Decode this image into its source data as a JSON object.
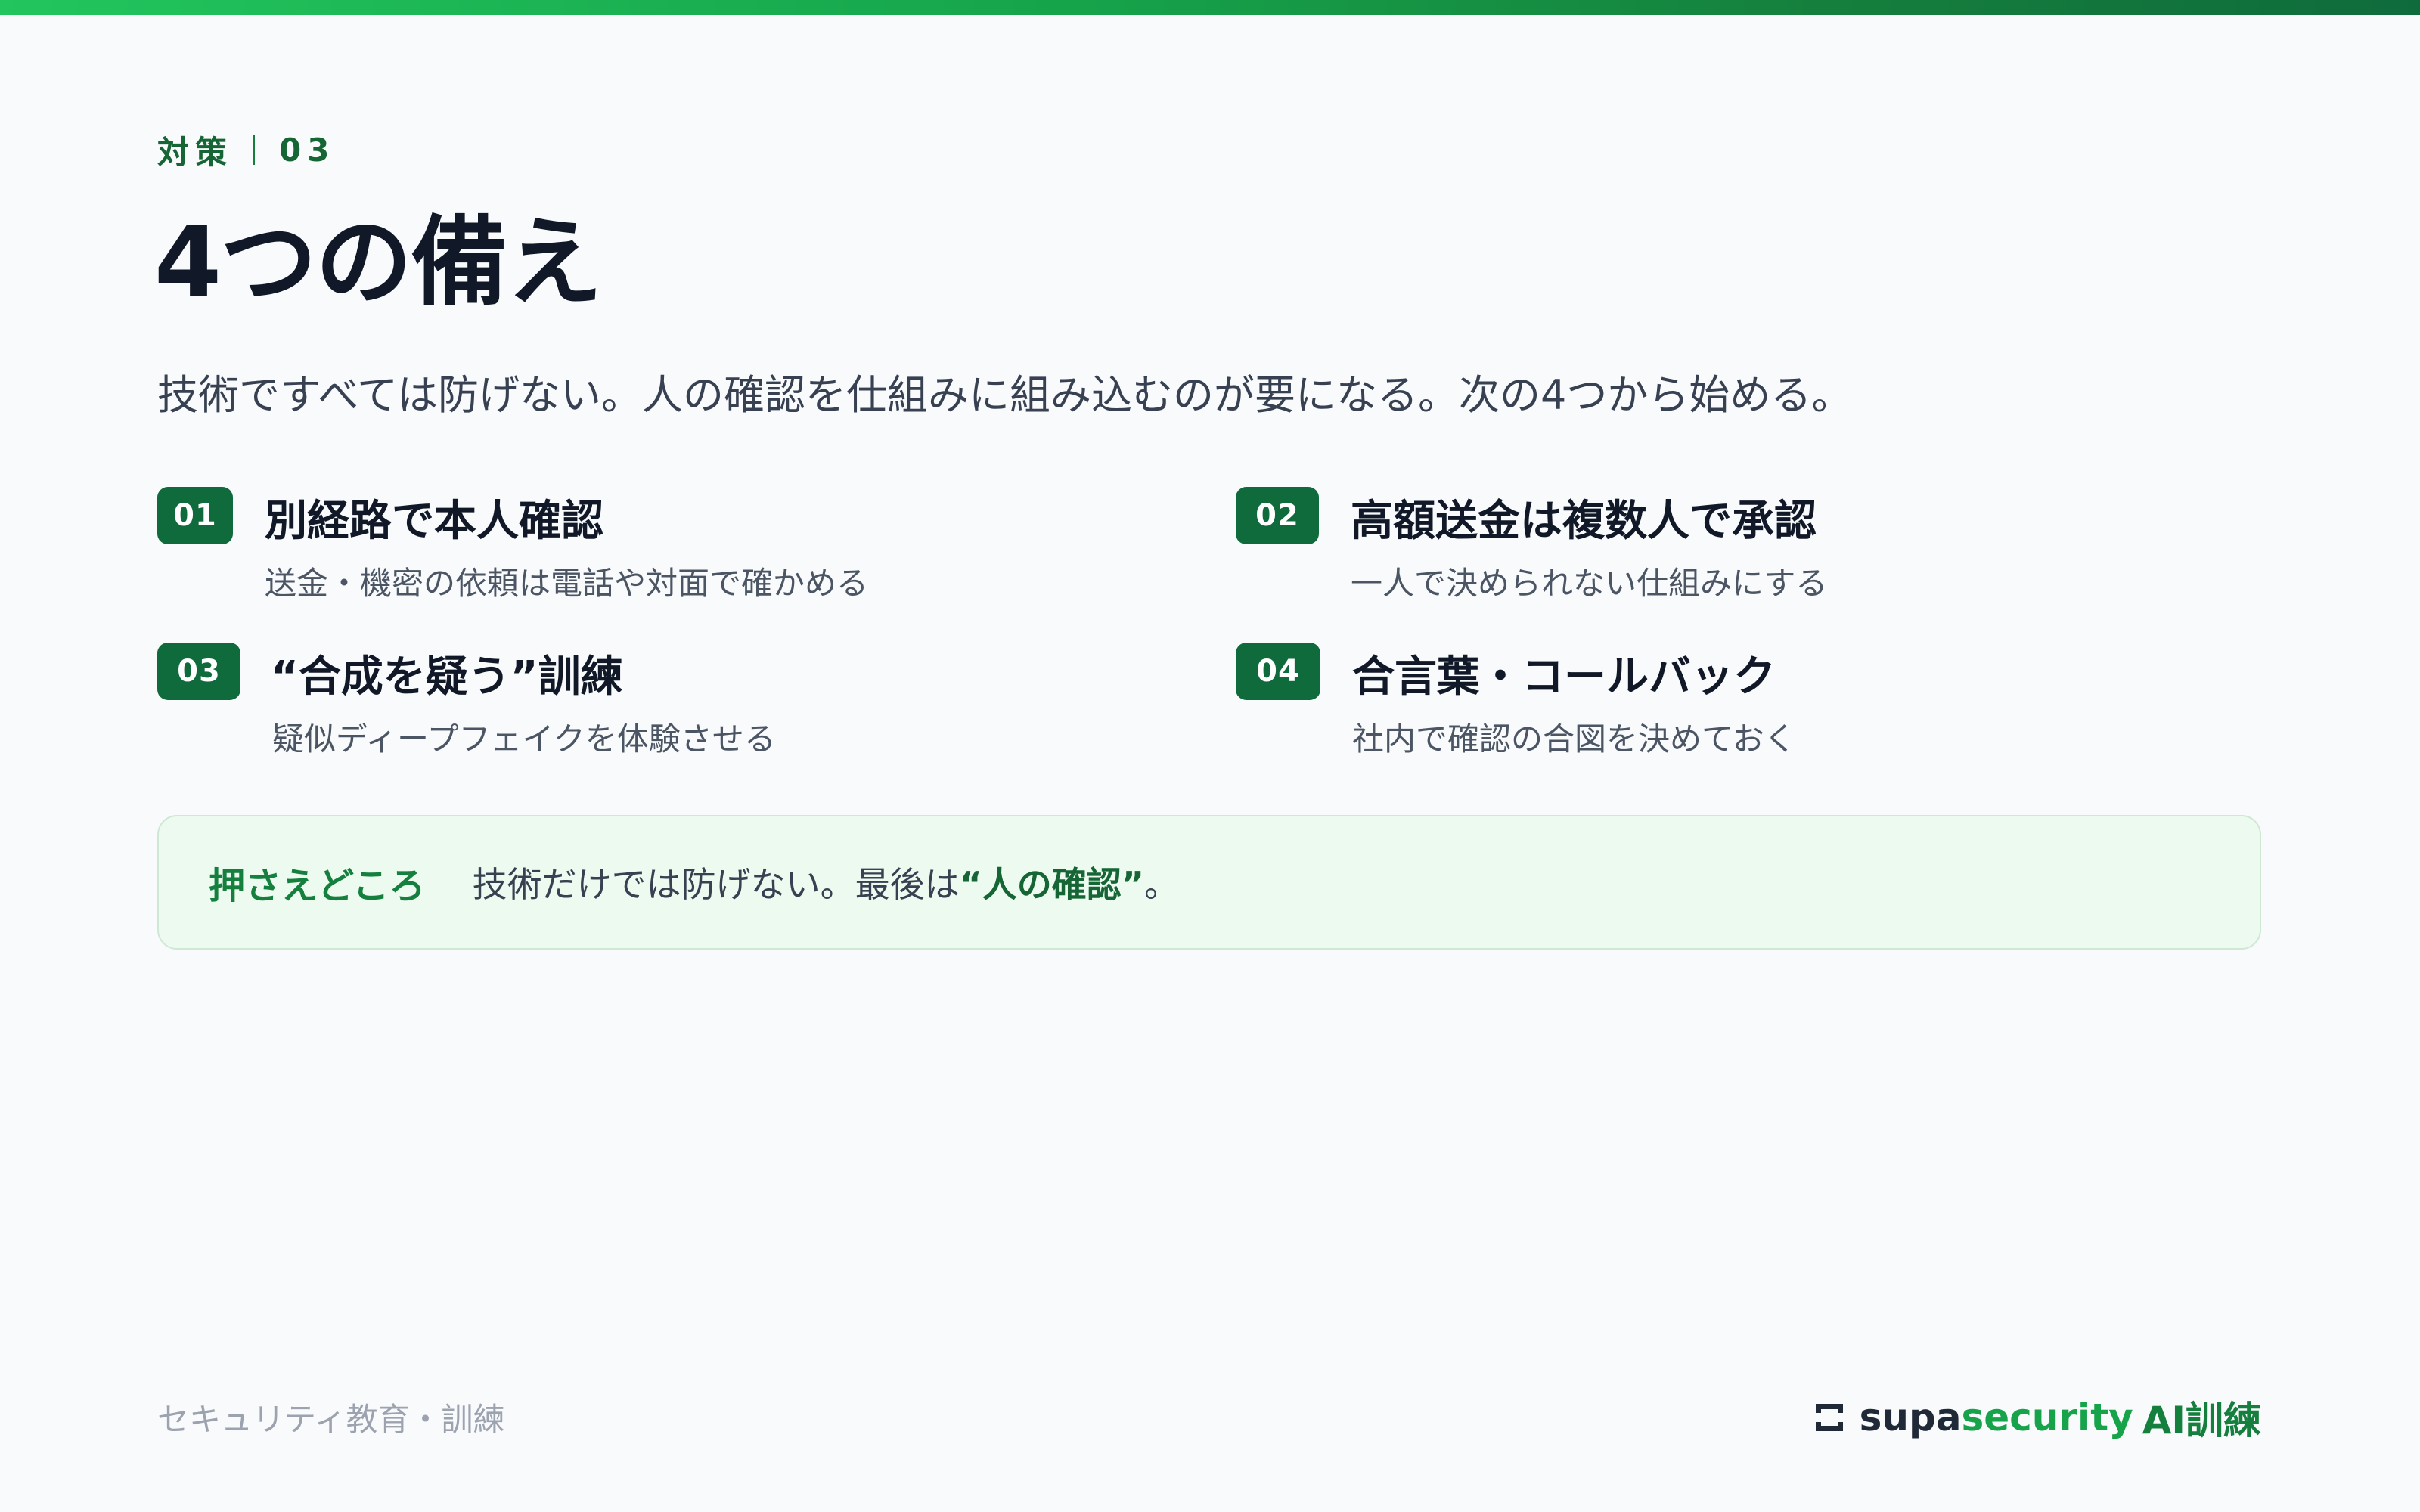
{
  "eyebrow": {
    "section": "対策",
    "number": "03"
  },
  "title": "4つの備え",
  "lead": "技術ですべては防げない。人の確認を仕組みに組み込むのが要になる。次の4つから始める。",
  "items": [
    {
      "badge": "01",
      "title": "別経路で本人確認",
      "desc": "送金・機密の依頼は電話や対面で確かめる"
    },
    {
      "badge": "02",
      "title": "高額送金は複数人で承認",
      "desc": "一人で決められない仕組みにする"
    },
    {
      "badge": "03",
      "title": "“合成を疑う”訓練",
      "desc": "疑似ディープフェイクを体験させる"
    },
    {
      "badge": "04",
      "title": "合言葉・コールバック",
      "desc": "社内で確認の合図を決めておく"
    }
  ],
  "callout": {
    "label": "押さえどころ",
    "text": "技術だけでは防げない。最後は",
    "emphasis": "“人の確認”",
    "suffix": "。"
  },
  "footer": {
    "left": "セキュリティ教育・訓練",
    "brand_part1": "supa",
    "brand_part2": "security",
    "brand_part3": "AI訓練"
  },
  "colors": {
    "accent": "#0f6b3c",
    "accent_light": "#16a34a",
    "background": "#f8fafc",
    "callout_bg": "#ecfaf0"
  },
  "icons": {
    "brand": "supasecurity-logo-icon"
  }
}
